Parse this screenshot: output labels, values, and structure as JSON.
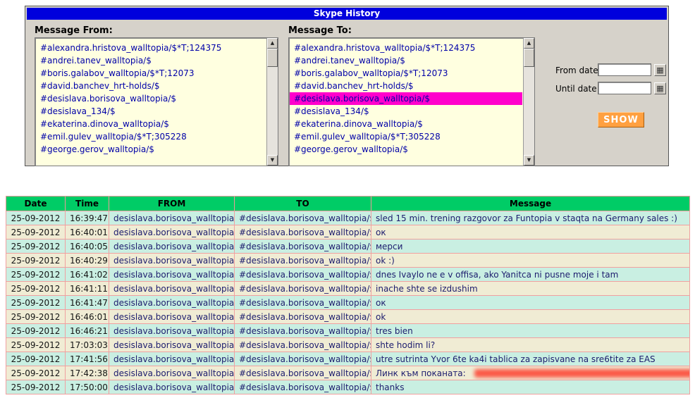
{
  "title": "Skype History",
  "from_panel": {
    "label": "Message From:",
    "items": [
      "#alexandra.hristova_walltopia/$*T;124375",
      "#andrei.tanev_walltopia/$",
      "#boris.galabov_walltopia/$*T;12073",
      "#david.banchev_hrt-holds/$",
      "#desislava.borisova_walltopia/$",
      "#desislava_134/$",
      "#ekaterina.dinova_walltopia/$",
      "#emil.gulev_walltopia/$*T;305228",
      "#george.gerov_walltopia/$"
    ],
    "selected_index": -1
  },
  "to_panel": {
    "label": "Message To:",
    "items": [
      "#alexandra.hristova_walltopia/$*T;124375",
      "#andrei.tanev_walltopia/$",
      "#boris.galabov_walltopia/$*T;12073",
      "#david.banchev_hrt-holds/$",
      "#desislava.borisova_walltopia/$",
      "#desislava_134/$",
      "#ekaterina.dinova_walltopia/$",
      "#emil.gulev_walltopia/$*T;305228",
      "#george.gerov_walltopia/$"
    ],
    "selected_index": 4
  },
  "filters": {
    "from_date_label": "From date:",
    "until_date_label": "Until date:",
    "from_date_value": "",
    "until_date_value": "",
    "show_label": "SHOW"
  },
  "icons": {
    "calendar": "▦",
    "scroll_up": "▲",
    "scroll_down": "▼"
  },
  "colors": {
    "titlebar_blue": "#0000dd",
    "selected_magenta": "#ff00cc",
    "header_green": "#00cc66",
    "row_cyan": "#c9efe2",
    "row_cream": "#f0ecd4",
    "show_button_orange": "#ffa040",
    "listbox_yellow": "#ffffe0",
    "grid_pink": "#f0a0a0"
  },
  "table": {
    "headers": [
      "Date",
      "Time",
      "FROM",
      "TO",
      "Message"
    ],
    "rows": [
      {
        "date": "25-09-2012",
        "time": "16:39:47",
        "from": "desislava.borisova_walltopia",
        "to": "#desislava.borisova_walltopia/$",
        "message": "sled 15 min. trening razgovor za Funtopia v staqta na Germany sales :)"
      },
      {
        "date": "25-09-2012",
        "time": "16:40:01",
        "from": "desislava.borisova_walltopia",
        "to": "#desislava.borisova_walltopia/$",
        "message": "ок"
      },
      {
        "date": "25-09-2012",
        "time": "16:40:05",
        "from": "desislava.borisova_walltopia",
        "to": "#desislava.borisova_walltopia/$",
        "message": "мерси"
      },
      {
        "date": "25-09-2012",
        "time": "16:40:29",
        "from": "desislava.borisova_walltopia",
        "to": "#desislava.borisova_walltopia/$",
        "message": "ok :)"
      },
      {
        "date": "25-09-2012",
        "time": "16:41:02",
        "from": "desislava.borisova_walltopia",
        "to": "#desislava.borisova_walltopia/$",
        "message": "dnes Ivaylo ne e v offisa, ako Yanitca ni pusne moje i tam"
      },
      {
        "date": "25-09-2012",
        "time": "16:41:11",
        "from": "desislava.borisova_walltopia",
        "to": "#desislava.borisova_walltopia/$",
        "message": "inache shte se izdushim"
      },
      {
        "date": "25-09-2012",
        "time": "16:41:47",
        "from": "desislava.borisova_walltopia",
        "to": "#desislava.borisova_walltopia/$",
        "message": "ок"
      },
      {
        "date": "25-09-2012",
        "time": "16:46:01",
        "from": "desislava.borisova_walltopia",
        "to": "#desislava.borisova_walltopia/$",
        "message": "ok"
      },
      {
        "date": "25-09-2012",
        "time": "16:46:21",
        "from": "desislava.borisova_walltopia",
        "to": "#desislava.borisova_walltopia/$",
        "message": "tres bien"
      },
      {
        "date": "25-09-2012",
        "time": "17:03:03",
        "from": "desislava.borisova_walltopia",
        "to": "#desislava.borisova_walltopia/$",
        "message": "shte hodim li?"
      },
      {
        "date": "25-09-2012",
        "time": "17:41:56",
        "from": "desislava.borisova_walltopia",
        "to": "#desislava.borisova_walltopia/$",
        "message": "utre sutrinta Yvor 6te ka4i tablica za zapisvane na sre6tite za EAS"
      },
      {
        "date": "25-09-2012",
        "time": "17:42:38",
        "from": "desislava.borisova_walltopia",
        "to": "#desislava.borisova_walltopia/$",
        "message": "Линк към поканата:",
        "redacted": true
      },
      {
        "date": "25-09-2012",
        "time": "17:50:00",
        "from": "desislava.borisova_walltopia",
        "to": "#desislava.borisova_walltopia/$",
        "message": "thanks"
      }
    ]
  }
}
